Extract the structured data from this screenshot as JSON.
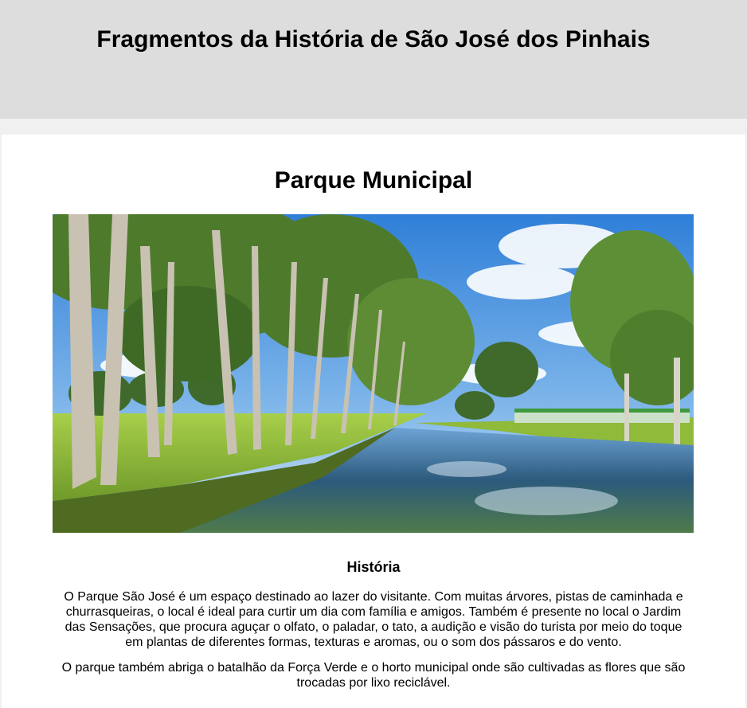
{
  "header": {
    "title": "Fragmentos da História de São José dos Pinhais"
  },
  "card": {
    "title": "Parque Municipal",
    "image": {
      "description_icon": "park-photo"
    },
    "section": {
      "heading": "História",
      "paragraphs": [
        "O Parque São José é um espaço destinado ao lazer do visitante. Com muitas árvores, pistas de caminhada e churrasqueiras, o local é ideal para curtir um dia com família e amigos. Também é presente no local o Jardim das Sensações, que procura aguçar o olfato, o paladar, o tato, a audição e visão do turista por meio do toque em plantas de diferentes formas, texturas e aromas, ou o som dos pássaros e do vento.",
        "O parque também abriga o batalhão da Força Verde e o horto municipal onde são cultivadas as flores que são trocadas por lixo reciclável."
      ]
    }
  },
  "colors": {
    "header_bg": "#dddddd",
    "page_bg": "#f0f0f0",
    "card_bg": "#ffffff",
    "sky": "#3d86d6",
    "water": "#2e5f86",
    "grass": "#8fbf3c"
  }
}
